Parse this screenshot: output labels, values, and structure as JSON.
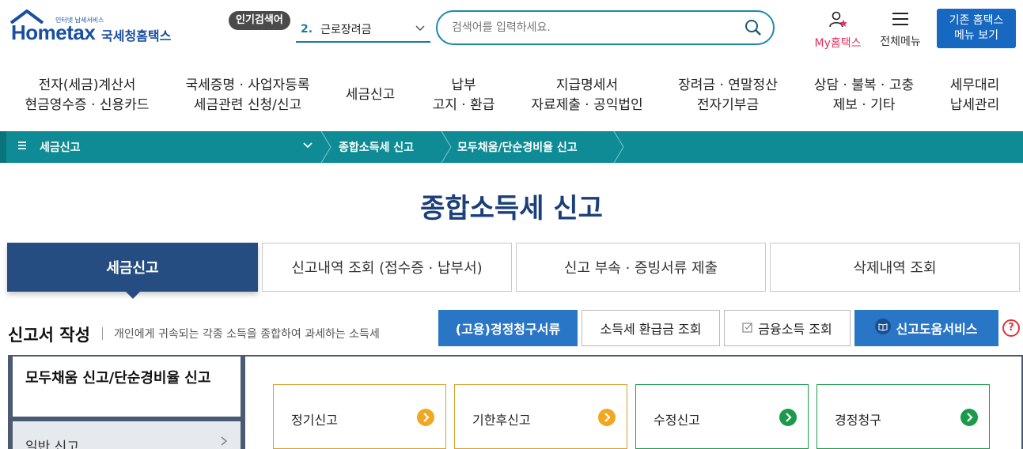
{
  "header": {
    "logo_tag": "인터넷 납세서비스",
    "logo_main": "Hometax",
    "logo_sub": "국세청홈택스",
    "popular_label": "인기검색어",
    "popular_rank": "2.",
    "popular_term": "근로장려금",
    "search_placeholder": "검색어를 입력하세요.",
    "my_label": "My홈택스",
    "allmenu_label": "전체메뉴",
    "old_home_line1": "기존 홈택스",
    "old_home_line2": "메뉴 보기"
  },
  "mainnav": [
    {
      "l1": "전자(세금)계산서",
      "l2": "현금영수증 · 신용카드"
    },
    {
      "l1": "국세증명 · 사업자등록",
      "l2": "세금관련 신청/신고"
    },
    {
      "l1": "세금신고",
      "l2": ""
    },
    {
      "l1": "납부",
      "l2": "고지 · 환급"
    },
    {
      "l1": "지급명세서",
      "l2": "자료제출 · 공익법인"
    },
    {
      "l1": "장려금 · 연말정산",
      "l2": "전자기부금"
    },
    {
      "l1": "상담 · 불복 · 고충",
      "l2": "제보 · 기타"
    },
    {
      "l1": "세무대리",
      "l2": "납세관리"
    }
  ],
  "breadcrumb": {
    "c1": "세금신고",
    "c2": "종합소득세 신고",
    "c3": "모두채움/단순경비율 신고"
  },
  "page_title": "종합소득세 신고",
  "tabs": [
    {
      "label": "세금신고"
    },
    {
      "label": "신고내역 조회 (접수증 · 납부서)"
    },
    {
      "label": "신고 부속 · 증빙서류 제출"
    },
    {
      "label": "삭제내역 조회"
    }
  ],
  "section": {
    "title": "신고서 작성",
    "desc": "개인에게 귀속되는 각종 소득을 종합하여 과세하는 소득세"
  },
  "buttons": {
    "b1": "(고용)경정청구서류",
    "b2": "소득세 환급금 조회",
    "b3": "금융소득 조회",
    "b4": "신고도움서비스"
  },
  "subnav": {
    "active": "모두채움 신고/단순경비율 신고",
    "item1": "일반 신고"
  },
  "cards": [
    {
      "label": "정기신고"
    },
    {
      "label": "기한후신고"
    },
    {
      "label": "수정신고"
    },
    {
      "label": "경정청구"
    }
  ],
  "colors": {
    "teal": "#0e8b95",
    "navy": "#264d82",
    "blue_button": "#2a76c6"
  }
}
